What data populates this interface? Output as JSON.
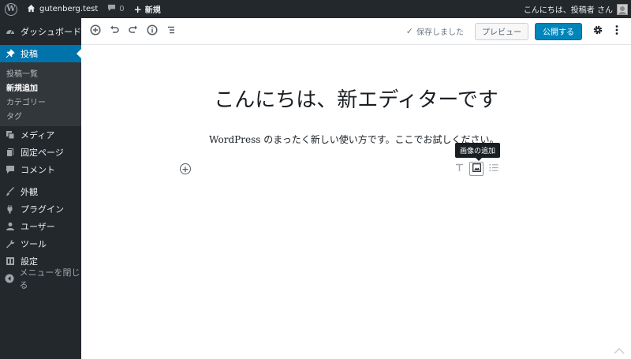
{
  "adminbar": {
    "site_name": "gutenberg.test",
    "comments_count": "0",
    "new_label": "新規",
    "greeting": "こんにちは、投稿者 さん"
  },
  "sidebar": {
    "items_top": [
      {
        "label": "ダッシュボード",
        "icon": "dashboard-icon"
      },
      {
        "label": "投稿",
        "icon": "pushpin-icon",
        "current": true
      }
    ],
    "submenu": [
      {
        "label": "投稿一覧"
      },
      {
        "label": "新規追加",
        "current": true
      },
      {
        "label": "カテゴリー"
      },
      {
        "label": "タグ"
      }
    ],
    "items_mid": [
      {
        "label": "メディア",
        "icon": "media-icon"
      },
      {
        "label": "固定ページ",
        "icon": "page-icon"
      },
      {
        "label": "コメント",
        "icon": "comment-icon"
      }
    ],
    "items_bottom": [
      {
        "label": "外観",
        "icon": "brush-icon"
      },
      {
        "label": "プラグイン",
        "icon": "plugin-icon"
      },
      {
        "label": "ユーザー",
        "icon": "user-icon"
      },
      {
        "label": "ツール",
        "icon": "wrench-icon"
      },
      {
        "label": "設定",
        "icon": "settings-icon"
      }
    ],
    "collapse_label": "メニューを閉じる"
  },
  "toolbar": {
    "saved_label": "保存しました",
    "preview_label": "プレビュー",
    "publish_label": "公開する"
  },
  "editor": {
    "title": "こんにちは、新エディターです",
    "paragraph": "WordPress のまったく新しい使い方です。ここでお試しください。",
    "tooltip": "画像の追加"
  },
  "colors": {
    "adminbar_bg": "#23282d",
    "accent": "#0073aa",
    "publish": "#0085ba"
  }
}
